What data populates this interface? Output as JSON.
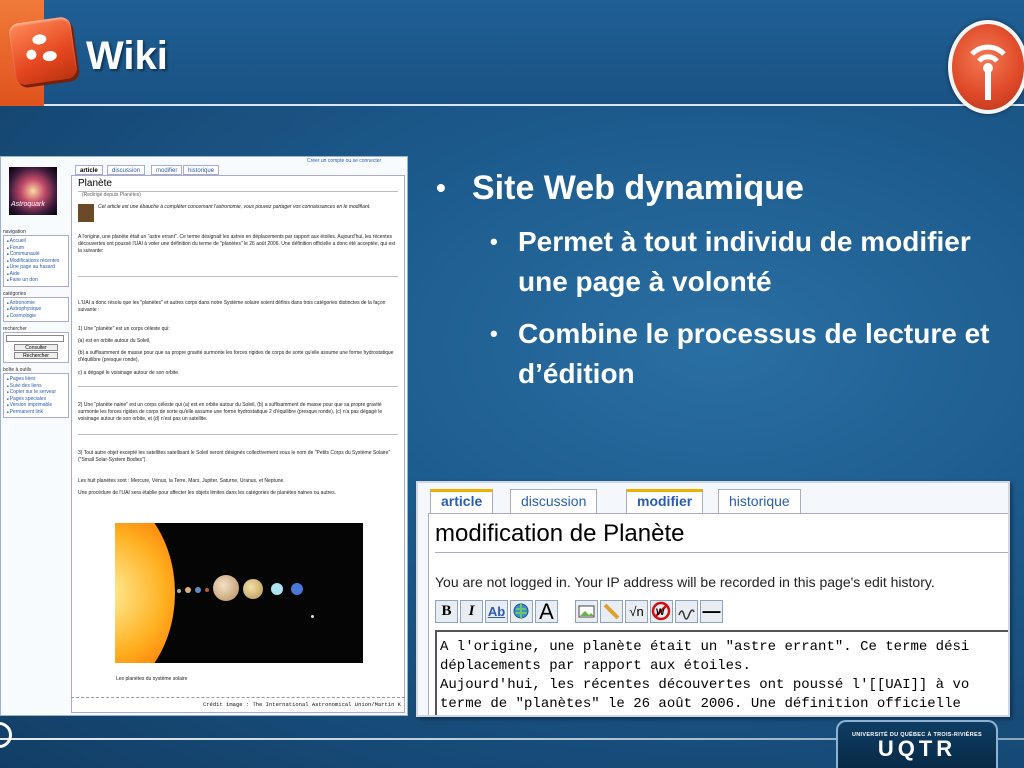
{
  "slide": {
    "title": "Wiki",
    "bullets": {
      "main": "Site Web dynamique",
      "subs": [
        "Permet à tout individu de modifier une page à volonté",
        "Combine le processus de lecture et d’édition"
      ]
    },
    "footer_logo": {
      "small_text": "UNIVERSITÉ DU QUÉBEC À TROIS-RIVIÈRES",
      "big_text": "UQTR"
    }
  },
  "wiki_screenshot": {
    "logo_text": "Astroquark",
    "login_link": "Créer un compte ou se connecter",
    "tabs": [
      "article",
      "discussion",
      "modifier",
      "historique"
    ],
    "page_title": "Planète",
    "redirect_note": "(Redirigé depuis Planètes)",
    "stub_notice": "Cet article est une ébauche à compléter concernant l'astronomie, vous pouvez partager vos connaissances en le modifiant.",
    "intro": "A l'origine, une planète était un \"astre errant\". Ce terme désignait les astres en déplacements par rapport aux étoiles. Aujourd'hui, les récentes découvertes ont poussé l'UAI à voter une définition du terme de \"planètes\" le 26 août 2006. Une définition officielle a donc été acceptée, qui est la suivante:",
    "uai_intro": "L'UAI a donc résolu que les \"planètes\" et autres corps dans notre Système solaire soient définis dans trois catégories distinctes de la façon suivante :",
    "def1_title": "1) Une \"planète\" est un corps céleste qui:",
    "def1_a": "(a) est en orbite autour du Soleil,",
    "def1_b": "(b) a suffisamment de masse pour que sa propre gravité surmonte les forces rigides de corps de sorte qu'elle assume une forme hydrostatique d'équilibre (presque ronde),",
    "def1_c": "c) a dégagé le voisinage autour de son orbite.",
    "def2": "2) Une \"planète naine\" est un corps céleste qui (a) est en orbite autour du Soleil, (b) a suffisamment de masse pour que sa propre gravité surmonte les forces rigides de corps de sorte qu'elle assume une forme hydrostatique 2 d'équilibre (presque ronde), (c) n'a pas dégagé le voisinage autour de son orbite, et (d) n'est pas un satellite.",
    "def3": "3) Tout autre objet excepté les satellites satellisant le Soleil seront désignés collectivement sous le nom de \"Petits Corps du Système Solaire\" (\"Small Solar-System Bodies\").",
    "eight_planets": "Les huit planètes sont : Mercure, Vénus, la Terre, Mars, Jupiter, Saturne, Uranus, et Neptune.",
    "procedure": "Une procédure de l'UAI sera établie pour affecter les objets limites dans les catégories de planètes naines ou autres.",
    "image_caption": "Les planètes du système solaire",
    "credit": "Crédit image : The International Astronomical Union/Martin K",
    "sidebar": {
      "navigation_title": "navigation",
      "navigation_items": [
        "Accueil",
        "Forum",
        "Communauté",
        "Modifications récentes",
        "Une page au hasard",
        "Aide",
        "Faire un don"
      ],
      "categories_title": "catégories",
      "categories_items": [
        "Astronomie",
        "Astrophysique",
        "Cosmologie"
      ],
      "search_title": "rechercher",
      "search_go": "Consulter",
      "search_button": "Rechercher",
      "toolbox_title": "boîte à outils",
      "toolbox_items": [
        "Pages liées",
        "Suivi des liens",
        "Copier sur le serveur",
        "Pages spéciales",
        "Version imprimable",
        "Permanent link"
      ]
    }
  },
  "edit_screenshot": {
    "tabs": [
      "article",
      "discussion",
      "modifier",
      "historique"
    ],
    "heading": "modification de Planète",
    "notice": "You are not logged in. Your IP address will be recorded in this page's edit history.",
    "toolbar": [
      "B",
      "I",
      "Ab",
      "globe-link",
      "A",
      "image",
      "media",
      "√n",
      "no-wiki",
      "signature",
      "—"
    ],
    "text_lines": [
      "A l'origine, une planète était un \"astre errant\". Ce terme dési",
      "déplacements par rapport aux étoiles.",
      "Aujourd'hui, les récentes découvertes ont poussé l'[[UAI]] à vo",
      "terme de \"planètes\" le 26 août 2006. Une définition officielle"
    ]
  },
  "colors": {
    "background": "#1c5a8c",
    "accent_orange": "#e5471f",
    "text_white": "#ffffff",
    "link_blue": "#2a5db0"
  }
}
